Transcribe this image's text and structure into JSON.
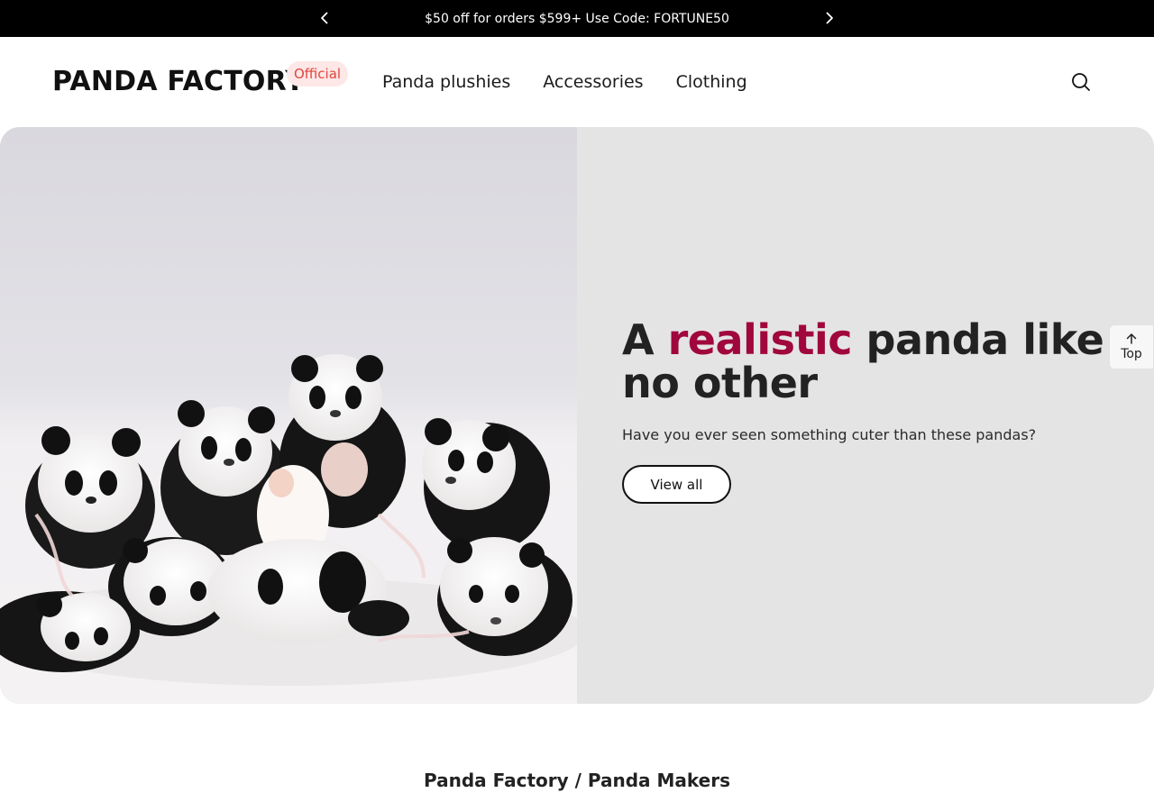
{
  "announcement": {
    "text": "$50 off for orders $599+ Use Code: FORTUNE50",
    "prev_icon": "chevron-left-icon",
    "next_icon": "chevron-right-icon"
  },
  "header": {
    "logo": "PANDA FACTORY",
    "logo_badge": "Official",
    "nav": [
      {
        "label": "Panda plushies"
      },
      {
        "label": "Accessories"
      },
      {
        "label": "Clothing"
      }
    ],
    "search_icon": "search-icon"
  },
  "hero": {
    "heading_prefix": "A",
    "heading_accent": "realistic",
    "heading_suffix": "panda like no other",
    "subtitle": "Have you ever seen something cuter than these pandas?",
    "button_label": "View all",
    "accent_color": "#a0073c",
    "image_subject": "group of panda plush toys with pink ribbons"
  },
  "top_button": {
    "label": "Top",
    "icon": "arrow-up-icon"
  },
  "section": {
    "heading": "Panda Factory / Panda Makers"
  }
}
